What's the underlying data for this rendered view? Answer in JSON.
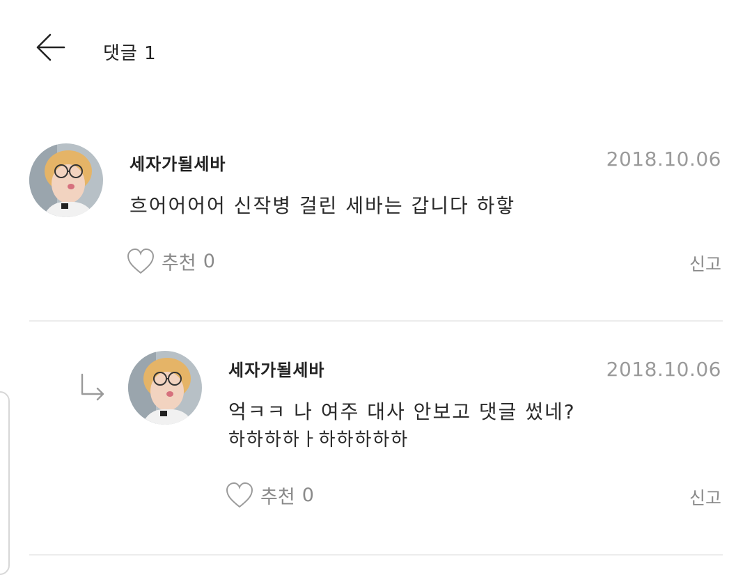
{
  "header": {
    "back_icon": "arrow-left-icon",
    "title": "댓글 1"
  },
  "comments": [
    {
      "author": "세자가될세바",
      "date": "2018.10.06",
      "text": "흐어어어어 신작병 걸린 세바는 갑니다 하핳",
      "like_label": "추천",
      "like_count": "0",
      "report_label": "신고"
    },
    {
      "author": "세자가될세바",
      "date": "2018.10.06",
      "text_line1": "억ㅋㅋ 나 여주 대사 안보고 댓글 썼네?",
      "text_line2": "하하하하ㅏ하하하하하",
      "like_label": "추천",
      "like_count": "0",
      "report_label": "신고"
    }
  ],
  "colors": {
    "text": "#222222",
    "muted": "#8a8a8a",
    "date": "#9a9a9a",
    "divider": "#ececec"
  }
}
